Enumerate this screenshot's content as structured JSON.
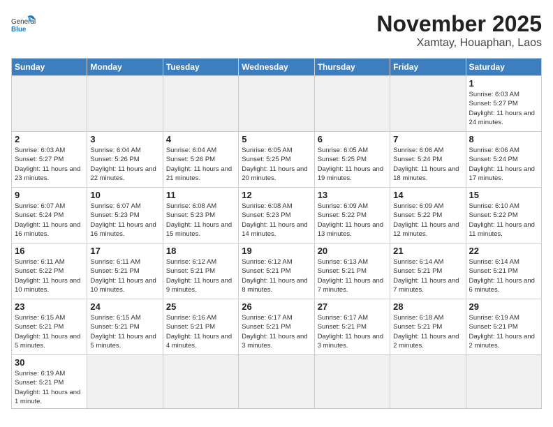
{
  "header": {
    "logo_line1": "General",
    "logo_line2": "Blue",
    "month": "November 2025",
    "location": "Xamtay, Houaphan, Laos"
  },
  "weekdays": [
    "Sunday",
    "Monday",
    "Tuesday",
    "Wednesday",
    "Thursday",
    "Friday",
    "Saturday"
  ],
  "weeks": [
    [
      {
        "day": "",
        "info": ""
      },
      {
        "day": "",
        "info": ""
      },
      {
        "day": "",
        "info": ""
      },
      {
        "day": "",
        "info": ""
      },
      {
        "day": "",
        "info": ""
      },
      {
        "day": "",
        "info": ""
      },
      {
        "day": "1",
        "info": "Sunrise: 6:03 AM\nSunset: 5:27 PM\nDaylight: 11 hours\nand 24 minutes."
      }
    ],
    [
      {
        "day": "2",
        "info": "Sunrise: 6:03 AM\nSunset: 5:27 PM\nDaylight: 11 hours\nand 23 minutes."
      },
      {
        "day": "3",
        "info": "Sunrise: 6:04 AM\nSunset: 5:26 PM\nDaylight: 11 hours\nand 22 minutes."
      },
      {
        "day": "4",
        "info": "Sunrise: 6:04 AM\nSunset: 5:26 PM\nDaylight: 11 hours\nand 21 minutes."
      },
      {
        "day": "5",
        "info": "Sunrise: 6:05 AM\nSunset: 5:25 PM\nDaylight: 11 hours\nand 20 minutes."
      },
      {
        "day": "6",
        "info": "Sunrise: 6:05 AM\nSunset: 5:25 PM\nDaylight: 11 hours\nand 19 minutes."
      },
      {
        "day": "7",
        "info": "Sunrise: 6:06 AM\nSunset: 5:24 PM\nDaylight: 11 hours\nand 18 minutes."
      },
      {
        "day": "8",
        "info": "Sunrise: 6:06 AM\nSunset: 5:24 PM\nDaylight: 11 hours\nand 17 minutes."
      }
    ],
    [
      {
        "day": "9",
        "info": "Sunrise: 6:07 AM\nSunset: 5:24 PM\nDaylight: 11 hours\nand 16 minutes."
      },
      {
        "day": "10",
        "info": "Sunrise: 6:07 AM\nSunset: 5:23 PM\nDaylight: 11 hours\nand 16 minutes."
      },
      {
        "day": "11",
        "info": "Sunrise: 6:08 AM\nSunset: 5:23 PM\nDaylight: 11 hours\nand 15 minutes."
      },
      {
        "day": "12",
        "info": "Sunrise: 6:08 AM\nSunset: 5:23 PM\nDaylight: 11 hours\nand 14 minutes."
      },
      {
        "day": "13",
        "info": "Sunrise: 6:09 AM\nSunset: 5:22 PM\nDaylight: 11 hours\nand 13 minutes."
      },
      {
        "day": "14",
        "info": "Sunrise: 6:09 AM\nSunset: 5:22 PM\nDaylight: 11 hours\nand 12 minutes."
      },
      {
        "day": "15",
        "info": "Sunrise: 6:10 AM\nSunset: 5:22 PM\nDaylight: 11 hours\nand 11 minutes."
      }
    ],
    [
      {
        "day": "16",
        "info": "Sunrise: 6:11 AM\nSunset: 5:22 PM\nDaylight: 11 hours\nand 10 minutes."
      },
      {
        "day": "17",
        "info": "Sunrise: 6:11 AM\nSunset: 5:21 PM\nDaylight: 11 hours\nand 10 minutes."
      },
      {
        "day": "18",
        "info": "Sunrise: 6:12 AM\nSunset: 5:21 PM\nDaylight: 11 hours\nand 9 minutes."
      },
      {
        "day": "19",
        "info": "Sunrise: 6:12 AM\nSunset: 5:21 PM\nDaylight: 11 hours\nand 8 minutes."
      },
      {
        "day": "20",
        "info": "Sunrise: 6:13 AM\nSunset: 5:21 PM\nDaylight: 11 hours\nand 7 minutes."
      },
      {
        "day": "21",
        "info": "Sunrise: 6:14 AM\nSunset: 5:21 PM\nDaylight: 11 hours\nand 7 minutes."
      },
      {
        "day": "22",
        "info": "Sunrise: 6:14 AM\nSunset: 5:21 PM\nDaylight: 11 hours\nand 6 minutes."
      }
    ],
    [
      {
        "day": "23",
        "info": "Sunrise: 6:15 AM\nSunset: 5:21 PM\nDaylight: 11 hours\nand 5 minutes."
      },
      {
        "day": "24",
        "info": "Sunrise: 6:15 AM\nSunset: 5:21 PM\nDaylight: 11 hours\nand 5 minutes."
      },
      {
        "day": "25",
        "info": "Sunrise: 6:16 AM\nSunset: 5:21 PM\nDaylight: 11 hours\nand 4 minutes."
      },
      {
        "day": "26",
        "info": "Sunrise: 6:17 AM\nSunset: 5:21 PM\nDaylight: 11 hours\nand 3 minutes."
      },
      {
        "day": "27",
        "info": "Sunrise: 6:17 AM\nSunset: 5:21 PM\nDaylight: 11 hours\nand 3 minutes."
      },
      {
        "day": "28",
        "info": "Sunrise: 6:18 AM\nSunset: 5:21 PM\nDaylight: 11 hours\nand 2 minutes."
      },
      {
        "day": "29",
        "info": "Sunrise: 6:19 AM\nSunset: 5:21 PM\nDaylight: 11 hours\nand 2 minutes."
      }
    ],
    [
      {
        "day": "30",
        "info": "Sunrise: 6:19 AM\nSunset: 5:21 PM\nDaylight: 11 hours\nand 1 minute."
      },
      {
        "day": "",
        "info": ""
      },
      {
        "day": "",
        "info": ""
      },
      {
        "day": "",
        "info": ""
      },
      {
        "day": "",
        "info": ""
      },
      {
        "day": "",
        "info": ""
      },
      {
        "day": "",
        "info": ""
      }
    ]
  ]
}
